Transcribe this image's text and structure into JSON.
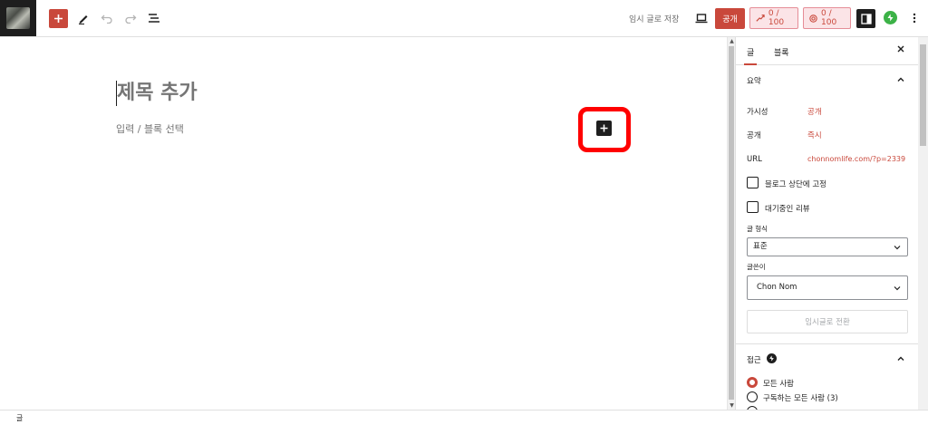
{
  "toolbar": {
    "save_draft_label": "임시 글로 저장",
    "publish_label": "공개",
    "seo_score": "0 / 100",
    "readability_score": "0 / 100"
  },
  "editor": {
    "title_placeholder": "제목 추가",
    "block_placeholder": "입력 / 블록 선택"
  },
  "sidebar": {
    "tabs": [
      {
        "label": "글",
        "active": true
      },
      {
        "label": "블록",
        "active": false
      }
    ],
    "summary": {
      "title": "요약",
      "visibility_label": "가시성",
      "visibility_value": "공개",
      "publish_label": "공개",
      "publish_value": "즉시",
      "url_label": "URL",
      "url_value": "chonnomlife.com/?p=2339",
      "sticky_label": "블로그 상단에 고정",
      "pending_label": "대기중인 리뷰",
      "format_label": "글 형식",
      "format_value": "표준",
      "author_label": "글쓴이",
      "author_value": "Chon Nom",
      "switch_draft_label": "임시글로 전환"
    },
    "access": {
      "title": "접근",
      "options": [
        {
          "label": "모든 사람",
          "selected": true
        },
        {
          "label": "구독하는 모든 사람 (3)",
          "selected": false
        }
      ]
    }
  },
  "footer": {
    "breadcrumb": "글"
  },
  "colors": {
    "accent": "#c9483b",
    "highlight": "#ff0000",
    "dark": "#1e1e1e",
    "jetpack": "#3cb247"
  }
}
